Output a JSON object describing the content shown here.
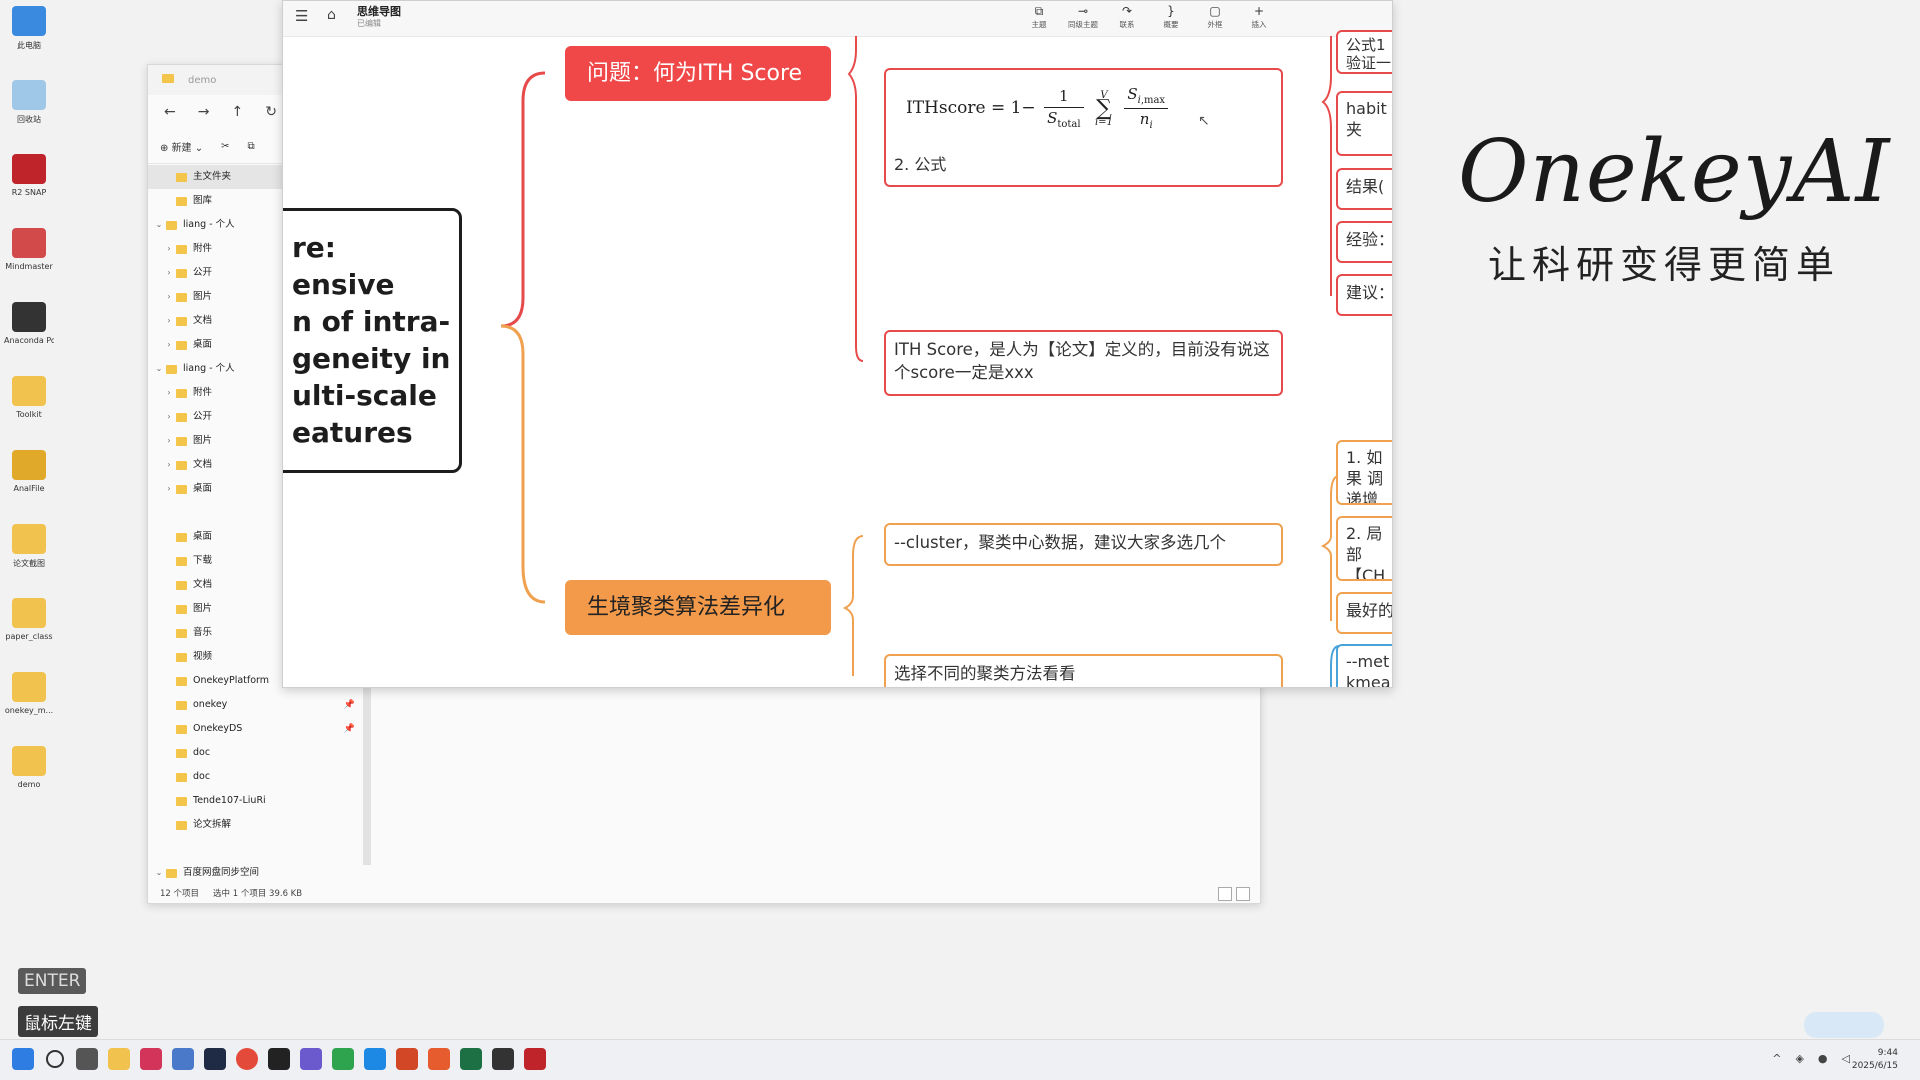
{
  "desktop": {
    "icons": [
      {
        "label": "此电脑",
        "color": "#3a8be0"
      },
      {
        "label": "回收站",
        "color": "#9fc8e8"
      },
      {
        "label": "R2 SNAP",
        "color": "#c0242b"
      },
      {
        "label": "Mindmaster",
        "color": "#d24a4a"
      },
      {
        "label": "Anaconda Powersh...",
        "color": "#333333"
      },
      {
        "label": "Toolkit",
        "color": "#f1c24d"
      },
      {
        "label": "AnalFile",
        "color": "#e0a92a"
      },
      {
        "label": "论文截图",
        "color": "#f1c24d"
      },
      {
        "label": "paper_class",
        "color": "#f1c24d"
      },
      {
        "label": "onekey_m...",
        "color": "#f1c24d"
      },
      {
        "label": "demo",
        "color": "#f1c24d"
      }
    ],
    "logo": "OnekeyAI",
    "slogan": "让科研变得更简单",
    "key_enter": "ENTER",
    "key_mouse": "鼠标左键"
  },
  "explorer": {
    "title": "demo",
    "nav": [
      "←",
      "→",
      "↑",
      "↻"
    ],
    "cmd_new": "新建",
    "sidebar": [
      {
        "label": "主文件夹",
        "indent": 1,
        "chev": "",
        "sel": true
      },
      {
        "label": "图库",
        "indent": 1,
        "chev": ""
      },
      {
        "label": "liang - 个人",
        "indent": 0,
        "chev": "⌄"
      },
      {
        "label": "附件",
        "indent": 1,
        "chev": "›"
      },
      {
        "label": "公开",
        "indent": 1,
        "chev": "›"
      },
      {
        "label": "图片",
        "indent": 1,
        "chev": "›"
      },
      {
        "label": "文档",
        "indent": 1,
        "chev": "›"
      },
      {
        "label": "桌面",
        "indent": 1,
        "chev": "›"
      },
      {
        "label": "liang - 个人",
        "indent": 0,
        "chev": "⌄"
      },
      {
        "label": "附件",
        "indent": 1,
        "chev": "›"
      },
      {
        "label": "公开",
        "indent": 1,
        "chev": "›"
      },
      {
        "label": "图片",
        "indent": 1,
        "chev": "›"
      },
      {
        "label": "文档",
        "indent": 1,
        "chev": "›"
      },
      {
        "label": "桌面",
        "indent": 1,
        "chev": "›"
      },
      {
        "label": "",
        "indent": 1,
        "chev": ""
      },
      {
        "label": "桌面",
        "indent": 1,
        "chev": ""
      },
      {
        "label": "下载",
        "indent": 1,
        "chev": ""
      },
      {
        "label": "文档",
        "indent": 1,
        "chev": ""
      },
      {
        "label": "图片",
        "indent": 1,
        "chev": ""
      },
      {
        "label": "音乐",
        "indent": 1,
        "chev": ""
      },
      {
        "label": "视频",
        "indent": 1,
        "chev": ""
      },
      {
        "label": "OnekeyPlatform",
        "indent": 1,
        "chev": "",
        "pin": true
      },
      {
        "label": "onekey",
        "indent": 1,
        "chev": "",
        "pin": true
      },
      {
        "label": "OnekeyDS",
        "indent": 1,
        "chev": "",
        "pin": true
      },
      {
        "label": "doc",
        "indent": 1,
        "chev": ""
      },
      {
        "label": "doc",
        "indent": 1,
        "chev": ""
      },
      {
        "label": "Tende107-LiuRi",
        "indent": 1,
        "chev": ""
      },
      {
        "label": "论文拆解",
        "indent": 1,
        "chev": ""
      },
      {
        "label": "",
        "indent": 1,
        "chev": ""
      },
      {
        "label": "百度网盘同步空间",
        "indent": 0,
        "chev": "⌄"
      }
    ],
    "status_items": "12 个项目",
    "status_selected": "选中 1 个项目 39.6 KB"
  },
  "mindmap": {
    "app_title": "思维导图",
    "app_sub": "已编辑",
    "tools": [
      {
        "glyph": "⧉",
        "label": "主题"
      },
      {
        "glyph": "⊸",
        "label": "同级主题"
      },
      {
        "glyph": "↷",
        "label": "联系"
      },
      {
        "glyph": "}",
        "label": "概要"
      },
      {
        "glyph": "▢",
        "label": "外框"
      },
      {
        "glyph": "+",
        "label": "插入"
      }
    ],
    "root_lines": [
      "re:",
      "ensive",
      "n of intra-",
      "geneity in",
      "ulti-scale",
      "eatures"
    ],
    "topic1": "问题：何为ITH Score",
    "topic2": "生境聚类算法差异化",
    "formula_label": "2. 公式",
    "formula_lhs": "ITHscore",
    "ith_note": "ITH Score，是人为【论文】定义的，目前没有说这个score一定是xxx",
    "cluster_note": "--cluster，聚类中心数据，建议大家多选几个",
    "method_note": "选择不同的聚类方法看看",
    "right_nodes_top": [
      "公式1 验证一",
      "habit 夹",
      "结果(",
      "经验：",
      "建议："
    ],
    "right_nodes_bottom": [
      "1. 如果 调递增",
      "2. 局部 【CH",
      "最好的",
      "--met kmea"
    ]
  }
}
